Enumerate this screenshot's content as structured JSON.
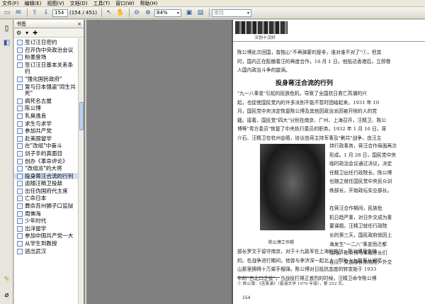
{
  "menu": [
    "文件(F)",
    "编辑(E)",
    "视图(V)",
    "文档(D)",
    "工具(T)",
    "窗口(W)",
    "帮助(H)"
  ],
  "toolbar": {
    "page_number": "154",
    "page_count": "(154 / 451)",
    "zoom": "84%",
    "search_placeholder": "查找"
  },
  "bookmarks": {
    "title": "书签",
    "close_label": "×",
    "items": [
      "签订汪日密约",
      "召开伪中央政治会议",
      "粉墨登场",
      "签订汪日基本关系条约",
      "\"强化国民政府\"",
      "誓与日本强盗\"同生共死\"",
      "病死名古屋",
      "陈公博",
      "乳臭逸良",
      "求生与求学",
      "参加共产党",
      "赴美国留学",
      "在\"改组\"中奋斗",
      "剑子手的真面目",
      "创办《革命评论》",
      "\"改组派\"的大将",
      "投身蒋汪合流的行列",
      "追随汪精卫投敌",
      "出任伪国府代主席",
      "亡命日本",
      "葬命苏州狮子口监狱",
      "周佛海",
      "少年时代",
      "出洋留学",
      "参加中国共产党一大",
      "从学生到教授",
      "逃出武汉"
    ],
    "selected_index": 16
  },
  "page": {
    "header_title": "汪伪十汉奸",
    "lines_top": [
      "陈公博此次回国，曾抱心\"不再弹蒙的是非，谁对谁不对了\"①，但其",
      "时，国内正在酝酿着汪的再度合作，10 月 1 日，他抵达香港后，立即卷",
      "入国内政治斗争的旋涡。"
    ],
    "heading": "投身蒋汪合流的行列",
    "lines_mid": [
      "\"九一八事变\"引起的民族危机，导致了全国抗日救亡高潮的兴",
      "起，也促使国民党内的许多派别不能不暂时团结起来。1931 年 10",
      "月，国民党中央决定恢复陈公博及其他因政治派因被开除的人的党",
      "籍。接着，国民党\"四大\"分别在南京、广州、上海召开，汪精卫、陈公",
      "博等\"粤方委员\"恢复了中央执行委员的职务。1932 年 1 月 16 日，蒋",
      "介石、汪精卫在杭州会晤，协议由蒋主持军事及\"剿共\"战争，由汪主"
    ],
    "lines_right": [
      "持行政事务，蒋汪合作局面再次",
      "形成。1 月 28 日，国民党中央",
      "临时政治会议通过决议，决定",
      "任精卫出任行政院长。陈公博",
      "也随之就任国民党中央民众训",
      "练部长，开始政坛实业部长。",
      "",
      "在蒋汪合作期间，民族危",
      "机日趋严重，对日外交成为重",
      "要课题。汪精卫就任行政院",
      "长的第三天，国民政府就因上",
      "海发生\"一二八\"事变而迁都",
      "洛阳。陈公博与军政界长们",
      "在汉、交通部长陈铭枢、外交"
    ],
    "lines_bottom": [
      "部长罗文干留守南京，对于十九路军在上海的抗战，陈公博是支持",
      "的。在战争进行期间，他曾与李济深一起北上，帮助十九路军从闸福",
      "山那里拥得十万架手榴弹。陈公博对日抵抗态度的转变始于 1933",
      "年的\"古北口之役\"，当战役打得正激烈的时候，汪精卫命令陈公博"
    ],
    "photo_caption": "陈公博工作照",
    "footnote": "① 陈公博：《苦笑录》（香港大学 1979 年版），第 252 页。",
    "page_number": "154"
  }
}
